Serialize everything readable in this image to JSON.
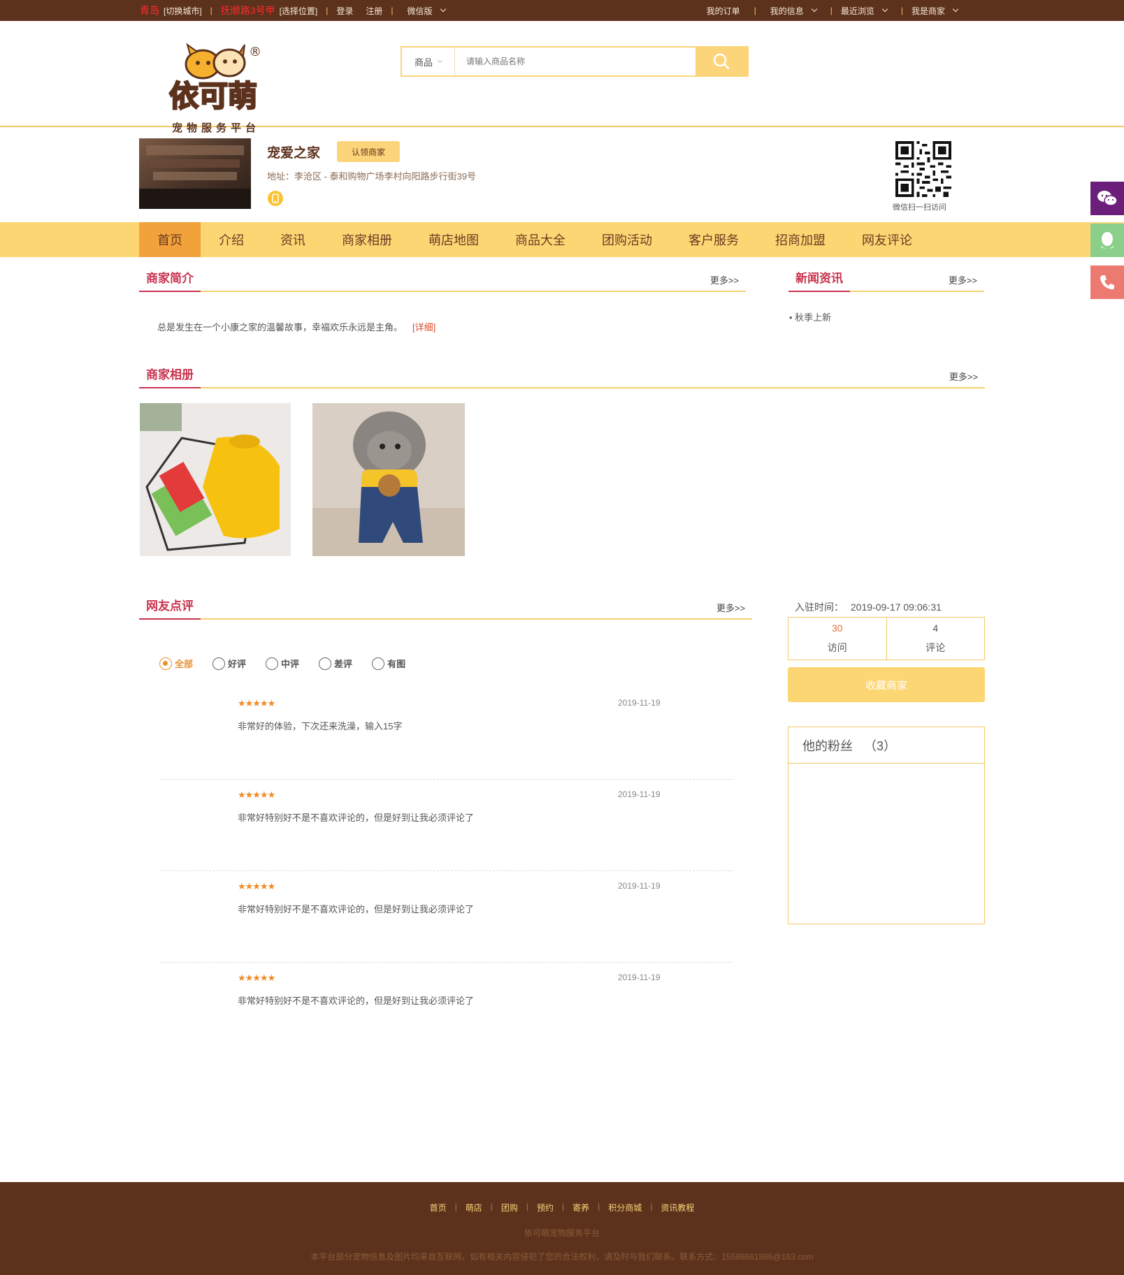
{
  "topbar": {
    "city": "青岛",
    "switch_city": "[切换城市]",
    "location": "抚顺路3号甲",
    "choose_location": "[选择位置]",
    "login": "登录",
    "register": "注册",
    "wechat": "微信版",
    "my_orders": "我的订单",
    "my_info": "我的信息",
    "recent": "最近浏览",
    "merchant": "我是商家"
  },
  "header": {
    "logo_trademark": "®",
    "logo_main": "依可萌",
    "logo_sub": "宠物服务平台",
    "search_category": "商品",
    "search_placeholder": "请输入商品名称"
  },
  "shop": {
    "name": "宠爱之家",
    "claim_label": "认领商家",
    "address": "地址：李沧区 - 泰和购物广场李村向阳路步行街39号",
    "qr_caption": "微信扫一扫访问"
  },
  "nav": {
    "items": [
      "首页",
      "介绍",
      "资讯",
      "商家相册",
      "萌店地图",
      "商品大全",
      "团购活动",
      "客户服务",
      "招商加盟",
      "网友评论"
    ]
  },
  "intro": {
    "title": "商家简介",
    "more": "更多>>",
    "text": "总是发生在一个小康之家的温馨故事，幸福欢乐永远是主角。",
    "detail": "[详细]"
  },
  "news": {
    "title": "新闻资讯",
    "more": "更多>>",
    "items": [
      "• 秋季上新"
    ]
  },
  "album": {
    "title": "商家相册",
    "more": "更多>>"
  },
  "reviews": {
    "title": "网友点评",
    "more": "更多>>",
    "filters": [
      "全部",
      "好评",
      "中评",
      "差评",
      "有图"
    ],
    "items": [
      {
        "stars": "★★★★★",
        "date": "2019-11-19",
        "text": "非常好的体验，下次还来洗澡，输入15字"
      },
      {
        "stars": "★★★★★",
        "date": "2019-11-19",
        "text": "非常好特别好不是不喜欢评论的，但是好到让我必须评论了"
      },
      {
        "stars": "★★★★★",
        "date": "2019-11-19",
        "text": "非常好特别好不是不喜欢评论的，但是好到让我必须评论了"
      },
      {
        "stars": "★★★★★",
        "date": "2019-11-19",
        "text": "非常好特别好不是不喜欢评论的，但是好到让我必须评论了"
      }
    ]
  },
  "sidebar": {
    "join_label": "入驻时间：",
    "join_time": "2019-09-17 09:06:31",
    "visits": "30",
    "visits_label": "访问",
    "comments": "4",
    "comments_label": "评论",
    "favorite": "收藏商家",
    "fans_label": "他的粉丝",
    "fans_count": "（3）"
  },
  "footer": {
    "links": [
      "首页",
      "萌店",
      "团购",
      "预约",
      "寄养",
      "积分商城",
      "资讯教程"
    ],
    "line2": "依可萌宠物服务平台",
    "line3": "本平台部分宠物信息及图片均来自互联网，如有相关内容侵犯了您的合法权利，请及时与我们联系。联系方式：15588661886@163.com"
  },
  "colors": {
    "brown": "#5c321d",
    "yellow": "#fdd674",
    "accent_red": "#c9344f",
    "orange": "#f2a23a"
  }
}
